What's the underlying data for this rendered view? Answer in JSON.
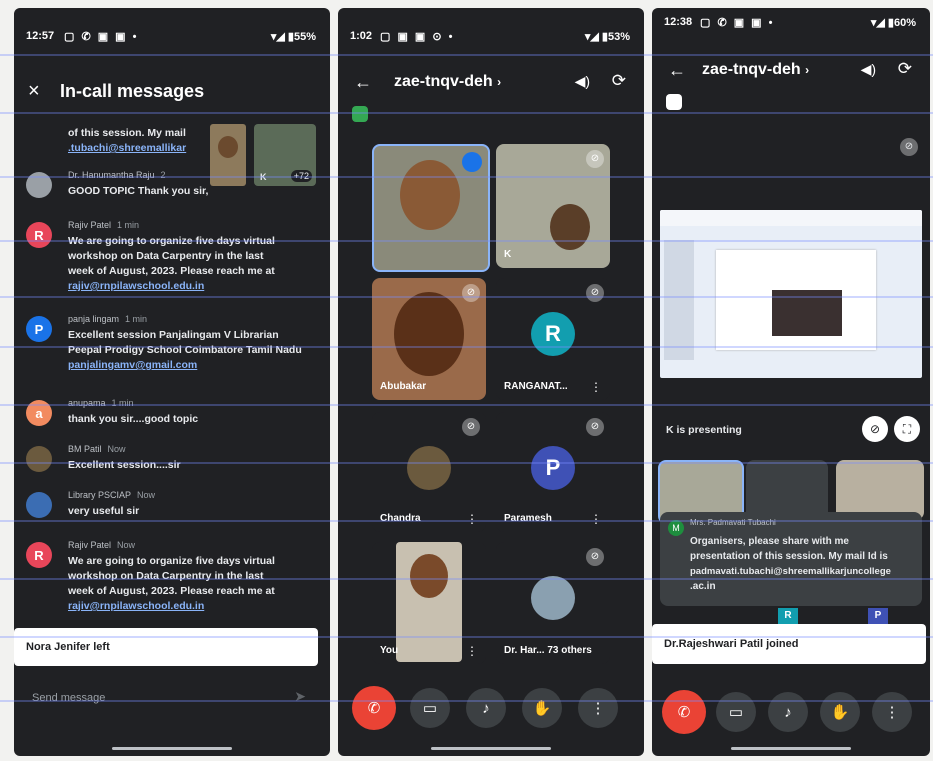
{
  "screens": [
    {
      "status": {
        "time": "12:57",
        "icons": "▢ ✆ ▣ ▣ •",
        "battery": "▾◢ ▮55%"
      },
      "header": {
        "close_icon": "×",
        "title": "In-call messages"
      },
      "messages": [
        {
          "avatar": "",
          "color": "#5f6368",
          "name": "",
          "time": "",
          "lines": [
            "of this session. My mail "
          ],
          "link": ".tubachi@shreemallikar"
        },
        {
          "avatar": "",
          "color": "#9aa0a6",
          "name": "Dr. Hanumantha Raju",
          "time": "2",
          "lines": [
            "GOOD TOPIC Thank you sir,"
          ],
          "link": ""
        },
        {
          "avatar": "R",
          "color": "#e8465a",
          "name": "Rajiv Patel",
          "time": "1 min",
          "lines": [
            "We are going to organize five days virtual",
            "workshop on Data Carpentry in the last",
            "week of August, 2023. Please reach me at"
          ],
          "link": "rajiv@rnpilawschool.edu.in"
        },
        {
          "avatar": "P",
          "color": "#1a73e8",
          "name": "panja lingam",
          "time": "1 min",
          "lines": [
            "Excellent session Panjalingam V Librarian",
            "Peepal Prodigy School Coimbatore Tamil Nadu"
          ],
          "link": "panjalingamv@gmail.com"
        },
        {
          "avatar": "a",
          "color": "#f28b60",
          "name": "anupama",
          "time": "1 min",
          "lines": [
            "thank you sir....good topic"
          ],
          "link": ""
        },
        {
          "avatar": "",
          "color": "#6b5a3e",
          "name": "BM Patil",
          "time": "Now",
          "lines": [
            "Excellent session....sir"
          ],
          "link": ""
        },
        {
          "avatar": "",
          "color": "#3b6db3",
          "name": "Library PSCIAP",
          "time": "Now",
          "lines": [
            "very useful sir"
          ],
          "link": ""
        },
        {
          "avatar": "R",
          "color": "#e8465a",
          "name": "Rajiv Patel",
          "time": "Now",
          "lines": [
            "We are going to organize five days virtual",
            "workshop on Data Carpentry in the last",
            "week of August, 2023. Please reach me at"
          ],
          "link": "rajiv@rnpilawschool.edu.in"
        }
      ],
      "pip": {
        "k_label": "K",
        "count": "+72"
      },
      "toast": "Nora Jenifer left",
      "send_placeholder": "Send message",
      "send_icon": "➤"
    },
    {
      "status": {
        "time": "1:02",
        "icons": "▢ ▣ ▣ ⊙ •",
        "battery": "▾◢ ▮53%"
      },
      "meeting_code": "zae-tnqv-deh",
      "code_suffix": "›",
      "back_icon": "←",
      "speaker_icon": "◀)",
      "flip_icon": "⟳",
      "tiles": [
        {
          "name": "",
          "kind": "video-active"
        },
        {
          "name": "K",
          "kind": "video"
        },
        {
          "name": "Abubakar",
          "kind": "video"
        },
        {
          "name": "RANGANAT...",
          "kind": "avatar",
          "letter": "R",
          "color": "#129eaf"
        },
        {
          "name": "Chandra",
          "kind": "photo"
        },
        {
          "name": "Paramesh",
          "kind": "avatar",
          "letter": "P",
          "color": "#3f51b5"
        },
        {
          "name": "You",
          "kind": "self"
        },
        {
          "name": "Dr. Har... 73 others",
          "kind": "group"
        }
      ],
      "controls": [
        "✆",
        "▭",
        "♪",
        "✋",
        "⋮"
      ]
    },
    {
      "status": {
        "time": "12:38",
        "icons": "▢ ✆ ▣ ▣ •",
        "battery": "▾◢ ▮60%"
      },
      "meeting_code": "zae-tnqv-deh",
      "code_suffix": "›",
      "back_icon": "←",
      "speaker_icon": "◀)",
      "flip_icon": "⟳",
      "presenting": "K is presenting",
      "chat_popup": {
        "avatar": "M",
        "name": "Mrs. Padmavati Tubachi",
        "lines": [
          "Organisers, please share with me",
          "presentation of this session. My mail Id is",
          "padmavati.tubachi@shreemallikarjuncollege",
          ".ac.in"
        ]
      },
      "mini_avatars": [
        "R",
        "P"
      ],
      "toast": "Dr.Rajeshwari Patil joined",
      "controls": [
        "✆",
        "▭",
        "♪",
        "✋",
        "⋮"
      ]
    }
  ]
}
